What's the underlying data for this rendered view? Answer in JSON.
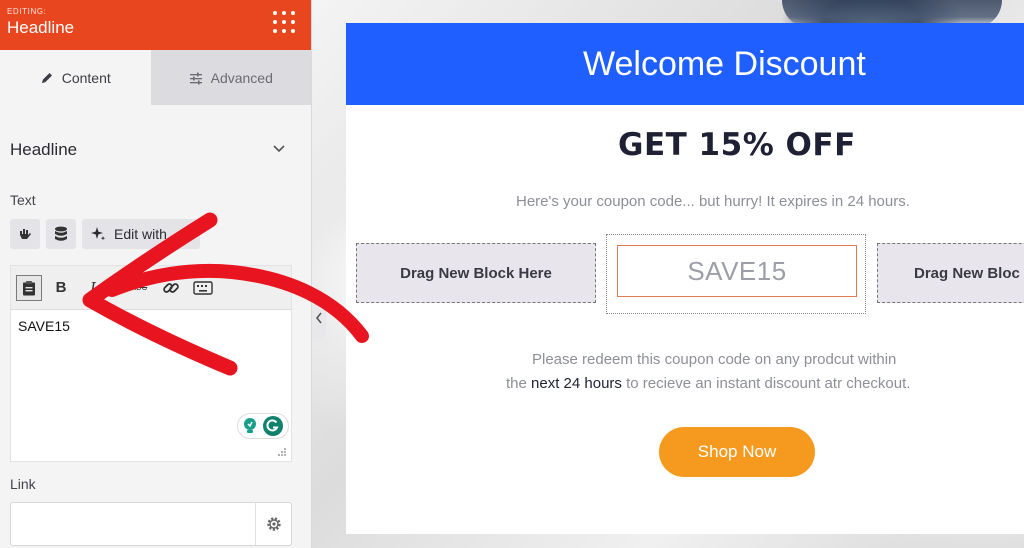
{
  "sidebar": {
    "kicker": "EDITING:",
    "title": "Headline",
    "tabs": [
      {
        "label": "Content"
      },
      {
        "label": "Advanced"
      }
    ],
    "section_title": "Headline",
    "text_label": "Text",
    "edit_with_label": "Edit with",
    "editor_value": "SAVE15",
    "toolbar": {
      "bold": "B",
      "italic": "I",
      "strike": "ABC"
    },
    "link_label": "Link",
    "link_value": ""
  },
  "popup": {
    "header": "Welcome Discount",
    "headline": "GET 15% OFF",
    "subtext": "Here's your coupon code... but hurry! It expires in 24 hours.",
    "block_left": "Drag New Block Here",
    "block_right": "Drag New Bloc",
    "coupon": "SAVE15",
    "redeem_line1": "Please redeem this coupon code on any prodcut within",
    "redeem_pre": "the ",
    "redeem_strong": "next 24 hours",
    "redeem_post": " to recieve an instant discount atr checkout.",
    "cta": "Shop Now"
  },
  "colors": {
    "sidebar_header": "#e8461f",
    "popup_header": "#1f5eff",
    "cta": "#f59a1e",
    "annotation_arrow": "#e8141f"
  }
}
